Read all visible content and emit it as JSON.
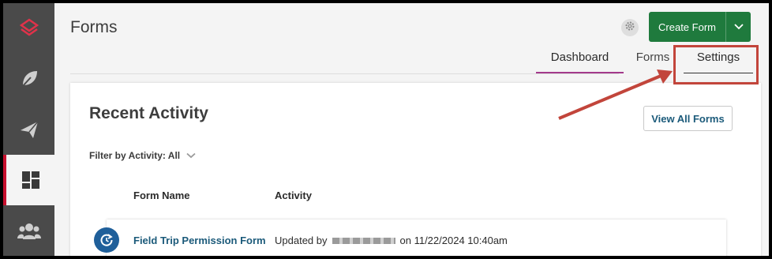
{
  "sidebar": {
    "items": [
      {
        "icon": "app-logo-icon"
      },
      {
        "icon": "leaf-icon"
      },
      {
        "icon": "paper-plane-icon"
      },
      {
        "icon": "dashboard-grid-icon",
        "active": true
      },
      {
        "icon": "users-icon"
      }
    ]
  },
  "header": {
    "title": "Forms",
    "create_form_label": "Create Form"
  },
  "tabs": {
    "dashboard": "Dashboard",
    "forms": "Forms",
    "settings": "Settings"
  },
  "card": {
    "title": "Recent Activity",
    "view_all_label": "View All Forms",
    "filter_label": "Filter by Activity: All",
    "columns": {
      "name": "Form Name",
      "activity": "Activity"
    },
    "rows": [
      {
        "name": "Field Trip Permission Form",
        "activity_prefix": "Updated by",
        "activity_suffix": "on 11/22/2024 10:40am"
      }
    ]
  },
  "colors": {
    "accent_red": "#c8102e",
    "primary_green": "#1f7a3d",
    "link_blue": "#1b5a7a",
    "annotation_red": "#c2453b"
  }
}
